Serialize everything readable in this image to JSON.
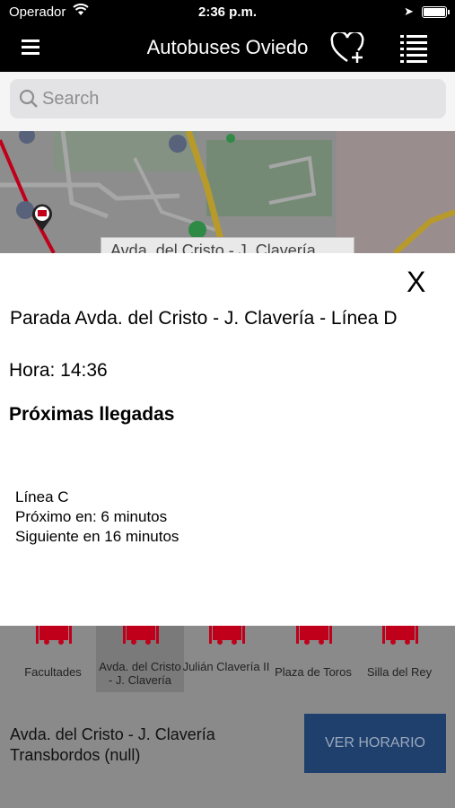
{
  "status": {
    "carrier": "Operador",
    "time": "2:36 p.m."
  },
  "nav": {
    "title": "Autobuses Oviedo",
    "menu_icon": "hamburger-icon",
    "fav_icon": "heart-plus-icon",
    "list_icon": "list-icon"
  },
  "search": {
    "placeholder": "Search"
  },
  "map": {
    "callout": "Avda. del Cristo - J. Clavería",
    "colors": {
      "road_major": "#b89a2a",
      "route": "#c0001a"
    }
  },
  "modal": {
    "close": "X",
    "stop_title": "Parada Avda. del Cristo - J. Clavería - Línea D",
    "hora": "Hora: 14:36",
    "proximas": "Próximas llegadas",
    "line": "Línea C",
    "next": "Próximo en: 6 minutos",
    "following": "Siguiente en 16 minutos"
  },
  "stops": [
    {
      "label": "Facultades",
      "selected": false
    },
    {
      "label": "Avda. del Cristo - J. Clavería",
      "selected": true
    },
    {
      "label": "Julián Clavería II",
      "selected": false
    },
    {
      "label": "Plaza de Toros",
      "selected": false
    },
    {
      "label": "Silla del Rey",
      "selected": false
    }
  ],
  "info": {
    "line1": "Avda. del Cristo - J. Clavería",
    "line2": "Transbordos (null)"
  },
  "button": {
    "label": "VER HORARIO"
  },
  "colors": {
    "accent": "#1f3f6c",
    "bus": "#c0001a"
  }
}
